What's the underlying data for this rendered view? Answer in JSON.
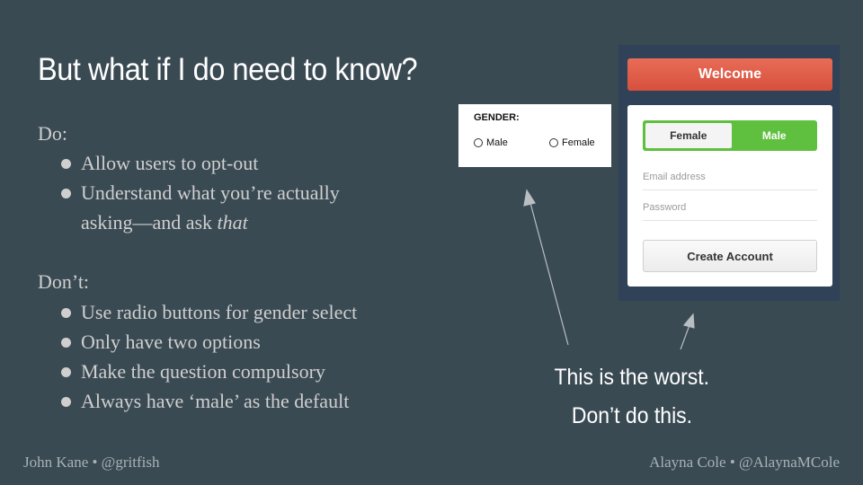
{
  "slide": {
    "title": "But what if I do need to know?",
    "do_heading": "Do:",
    "do_items": [
      {
        "text": "Allow users to opt-out"
      },
      {
        "text": "Understand what you’re actually asking—and ask ",
        "emph": "that"
      }
    ],
    "dont_heading": "Don’t:",
    "dont_items": [
      "Use radio buttons for gender select",
      "Only have two options",
      "Make the question compulsory",
      "Always have ‘male’ as the default"
    ],
    "caption_line1": "This is the worst.",
    "caption_line2": "Don’t do this.",
    "footer_left": "John Kane • @gritfish",
    "footer_right": "Alayna Cole • @AlaynaMCole"
  },
  "radio_example": {
    "label": "GENDER:",
    "options": [
      "Male",
      "Female"
    ]
  },
  "signup_example": {
    "welcome": "Welcome",
    "toggle_options": [
      "Female",
      "Male"
    ],
    "email_placeholder": "Email address",
    "password_placeholder": "Password",
    "button": "Create Account"
  },
  "colors": {
    "background": "#3a4a53",
    "welcome_bar": "#d6503d",
    "toggle_active": "#5fbf3f",
    "panel": "#2f4257"
  }
}
